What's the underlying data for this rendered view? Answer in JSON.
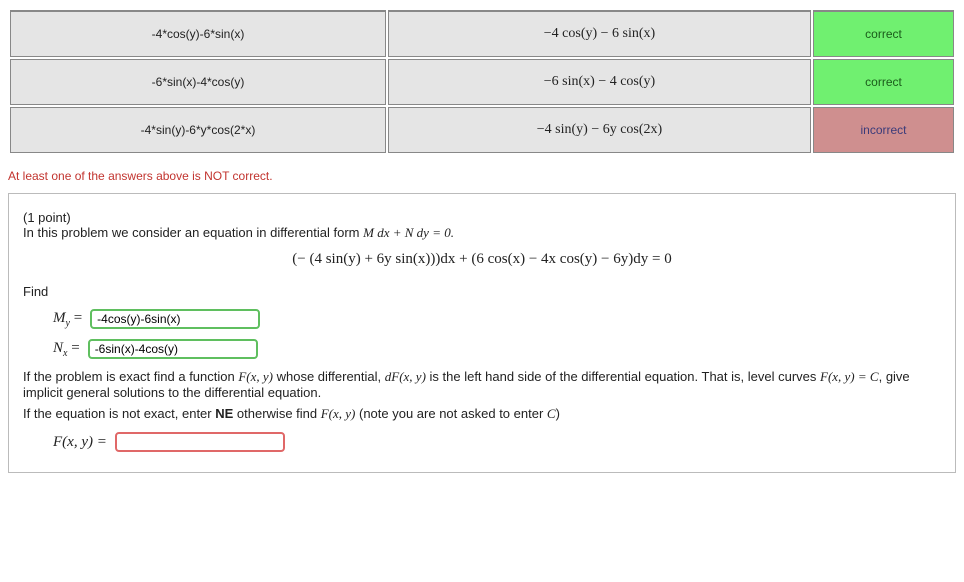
{
  "results": {
    "rows": [
      {
        "entered": "-4*cos(y)-6*sin(x)",
        "preview": "−4 cos(y) − 6 sin(x)",
        "status": "correct",
        "status_class": "correct"
      },
      {
        "entered": "-6*sin(x)-4*cos(y)",
        "preview": "−6 sin(x) − 4 cos(y)",
        "status": "correct",
        "status_class": "correct"
      },
      {
        "entered": "-4*sin(y)-6*y*cos(2*x)",
        "preview": "−4 sin(y) − 6y cos(2x)",
        "status": "incorrect",
        "status_class": "incorrect"
      }
    ]
  },
  "warning": "At least one of the answers above is NOT correct.",
  "problem": {
    "points": "(1 point)",
    "intro": "In this problem we consider an equation in differential form ",
    "intro_math": "M dx + N dy = 0.",
    "equation": "(− (4 sin(y) + 6y sin(x)))dx + (6 cos(x) − 4x cos(y) − 6y)dy = 0",
    "find_label": "Find",
    "My_label": "M",
    "My_sub": "y",
    "Nx_label": "N",
    "Nx_sub": "x",
    "eq_sign": " = ",
    "My_value": "-4cos(y)-6sin(x)",
    "Nx_value": "-6sin(x)-4cos(y)",
    "para1_a": "If the problem is exact find a function ",
    "para1_m1": "F(x, y)",
    "para1_b": " whose differential, ",
    "para1_m2": "dF(x, y)",
    "para1_c": " is the left hand side of the differential equation. That is, level curves ",
    "para1_m3": "F(x, y) = C",
    "para1_d": ", give implicit general solutions to the differential equation.",
    "para2_a": "If the equation is not exact, enter ",
    "para2_ne": "NE",
    "para2_b": " otherwise find ",
    "para2_m1": "F(x, y)",
    "para2_c": " (note you are not asked to enter ",
    "para2_m2": "C",
    "para2_d": ")",
    "Fxy_label": "F(x, y) = ",
    "Fxy_value": ""
  }
}
